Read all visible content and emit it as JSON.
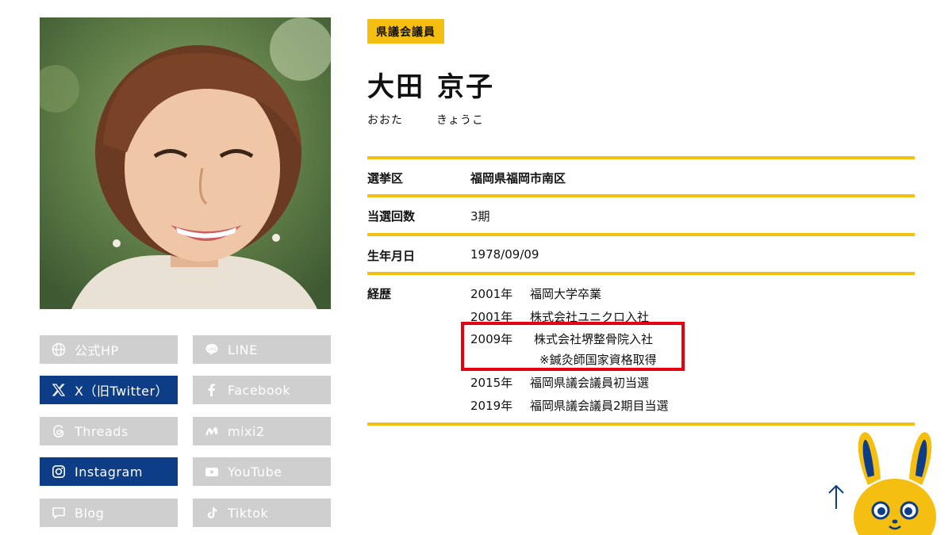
{
  "profile": {
    "badge": "県議会議員",
    "family_name": "大田",
    "given_name": "京子",
    "family_kana": "おおた",
    "given_kana": "きょうこ"
  },
  "details": {
    "district_label": "選挙区",
    "district_value": "福岡県福岡市南区",
    "terms_label": "当選回数",
    "terms_value": "3期",
    "birth_label": "生年月日",
    "birth_value": "1978/09/09",
    "career_label": "経歴",
    "career": [
      {
        "year": "2001年",
        "text": "福岡大学卒業"
      },
      {
        "year": "2001年",
        "text": "株式会社ユニクロ入社"
      },
      {
        "year": "2009年",
        "text": "株式会社堺整骨院入社"
      },
      {
        "year": "",
        "text": "※鍼灸師国家資格取得"
      },
      {
        "year": "2015年",
        "text": "福岡県議会議員初当選"
      },
      {
        "year": "2019年",
        "text": "福岡県議会議員2期目当選"
      }
    ]
  },
  "social": {
    "official_hp": "公式HP",
    "line": "LINE",
    "x_twitter": "X（旧Twitter）",
    "facebook": "Facebook",
    "threads": "Threads",
    "mixi2": "mixi2",
    "instagram": "Instagram",
    "youtube": "YouTube",
    "blog": "Blog",
    "tiktok": "Tiktok"
  },
  "colors": {
    "accent": "#f5bf12",
    "active_button": "#0d3d86",
    "inactive_button": "#cfcfcf",
    "highlight_box": "#e50012"
  }
}
